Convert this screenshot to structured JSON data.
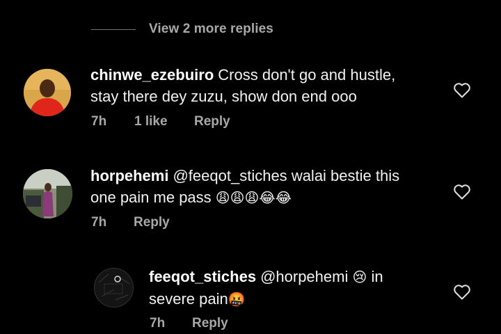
{
  "view_more": {
    "label": "View 2 more replies"
  },
  "comments": [
    {
      "username": "chinwe_ezebuiro",
      "text_line1": "Cross don't go and hustle,",
      "text_line2": "stay there dey zuzu, show don end ooo",
      "time": "7h",
      "likes": "1 like",
      "reply": "Reply"
    },
    {
      "username": "horpehemi",
      "mention": "@feeqot_stiches",
      "text_line1": "walai bestie this",
      "text_line2": "one pain me pass",
      "emojis": "😩😩😩😂😂",
      "time": "7h",
      "reply": "Reply"
    },
    {
      "username": "feeqot_stiches",
      "mention": "@horpehemi",
      "emoji1": "😢",
      "text_line1": "in",
      "text_line2": "severe pain",
      "emoji2": "🤬",
      "time": "7h",
      "reply": "Reply"
    }
  ],
  "icons": [
    "heart-icon",
    "avatar"
  ],
  "colors": {
    "background": "#000000",
    "text": "#f5f5f5",
    "muted": "#a8a8a8"
  }
}
